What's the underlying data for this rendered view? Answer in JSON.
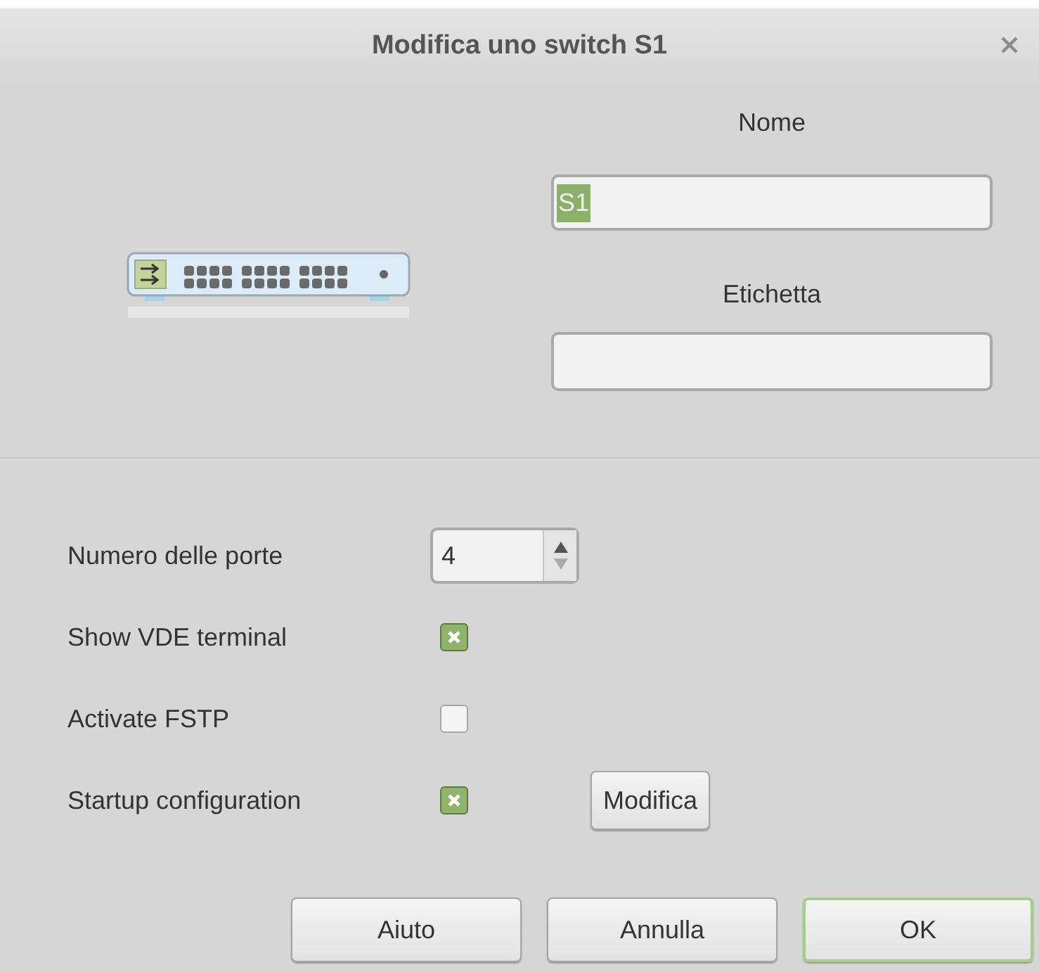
{
  "window": {
    "title": "Modifica uno switch S1"
  },
  "name_field": {
    "label": "Nome",
    "value": "S1",
    "value_highlighted": true
  },
  "label_field": {
    "label": "Etichetta"
  },
  "options": [
    {
      "kind": "spin",
      "label": "Numero delle porte",
      "value": "4"
    },
    {
      "kind": "checkbox",
      "label": "Show VDE terminal",
      "checked": true
    },
    {
      "kind": "checkbox",
      "label": "Activate FSTP",
      "checked": false
    },
    {
      "kind": "checkbox",
      "label": "Startup configuration",
      "checked": true,
      "button": "Modifica"
    }
  ],
  "buttons": [
    {
      "label": "Aiuto",
      "default": false
    },
    {
      "label": "Annulla",
      "default": false
    },
    {
      "label": "OK",
      "default": true
    }
  ]
}
